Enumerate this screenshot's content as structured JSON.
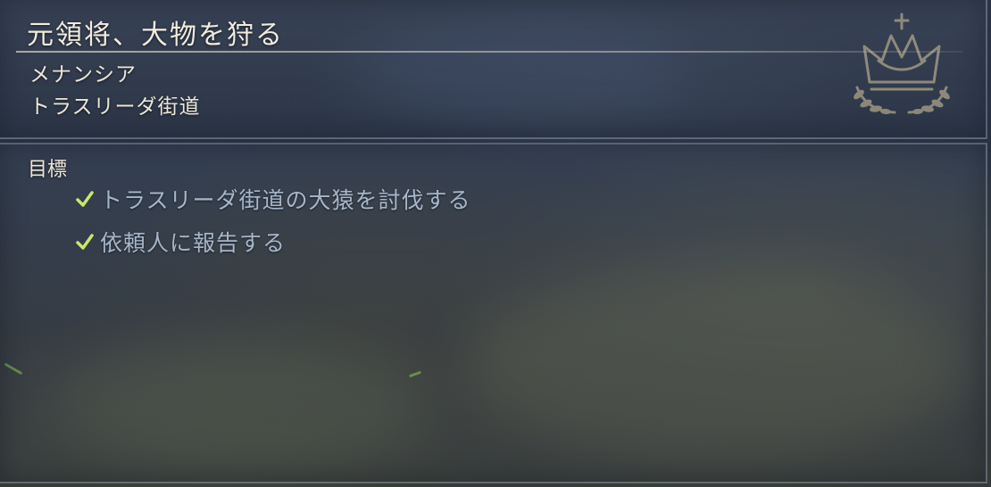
{
  "quest": {
    "title": "元領将、大物を狩る",
    "client": "メナンシア",
    "location": "トラスリーダ街道"
  },
  "objectives": {
    "heading": "目標",
    "items": [
      {
        "text": "トラスリーダ街道の大猿を討伐する",
        "completed": true,
        "icon": "checkmark-icon"
      },
      {
        "text": "依頼人に報告する",
        "completed": true,
        "icon": "checkmark-icon"
      }
    ]
  },
  "emblem": {
    "icon": "crown-laurel-icon"
  },
  "colors": {
    "title_text": "#f1ece0",
    "objective_text": "#a6b6ca",
    "checkmark": "#c9e86a",
    "panel_border": "#8c96a5"
  }
}
